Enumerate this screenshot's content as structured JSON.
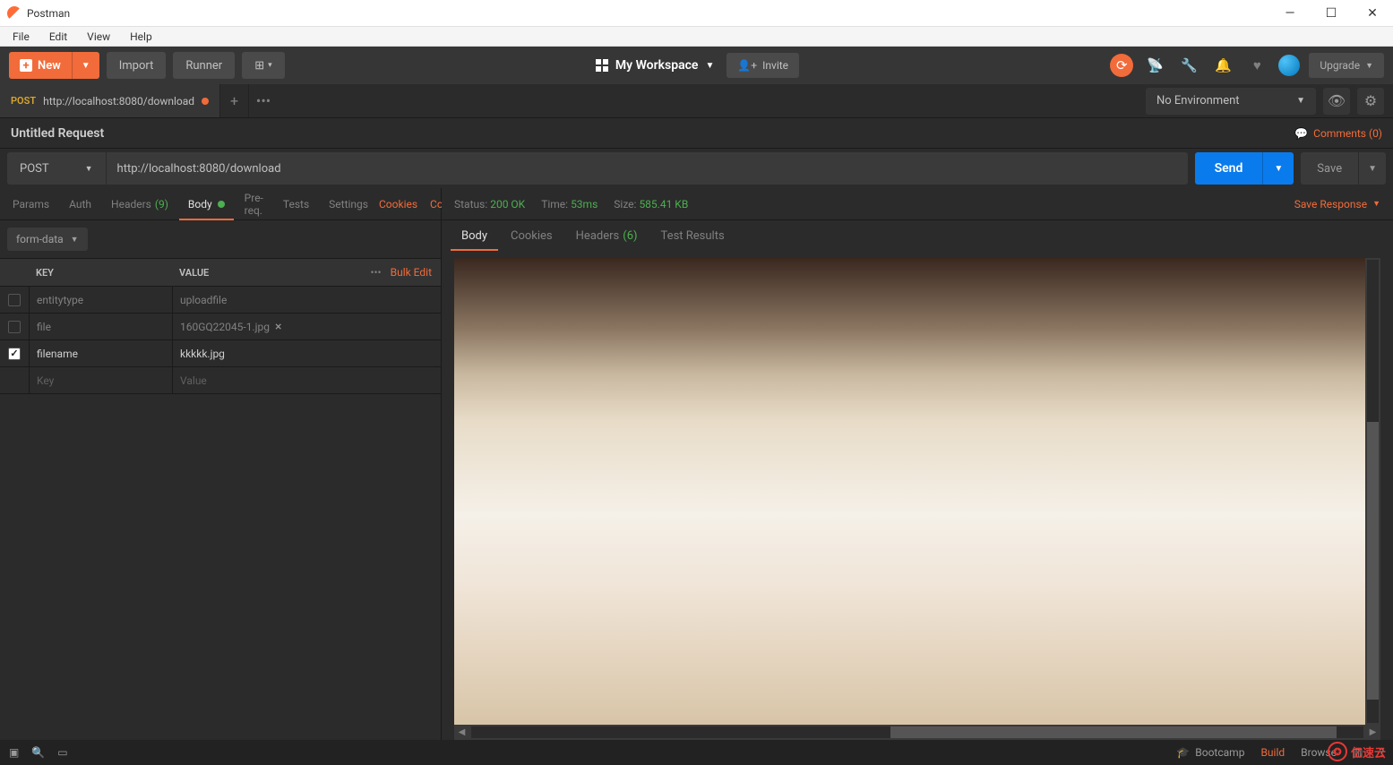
{
  "window": {
    "app_name": "Postman"
  },
  "menus": [
    "File",
    "Edit",
    "View",
    "Help"
  ],
  "toolbar": {
    "new_label": "New",
    "import_label": "Import",
    "runner_label": "Runner",
    "workspace_label": "My Workspace",
    "invite_label": "Invite",
    "upgrade_label": "Upgrade"
  },
  "tabs": {
    "open": [
      {
        "method": "POST",
        "title": "http://localhost:8080/download",
        "dirty": true
      }
    ],
    "env_label": "No Environment"
  },
  "request": {
    "name": "Untitled Request",
    "comments_label": "Comments (0)",
    "method": "POST",
    "url": "http://localhost:8080/download",
    "send_label": "Send",
    "save_label": "Save",
    "req_tabs": {
      "params": "Params",
      "auth": "Auth",
      "headers": "Headers",
      "headers_count": "(9)",
      "body": "Body",
      "prereq": "Pre-req.",
      "tests": "Tests",
      "settings": "Settings",
      "cookies": "Cookies",
      "code": "Code"
    },
    "body_type": "form-data",
    "form_headers": {
      "key": "KEY",
      "value": "VALUE",
      "bulk_edit": "Bulk Edit"
    },
    "form_rows": [
      {
        "checked": false,
        "key": "entitytype",
        "value": "uploadfile",
        "type": "text"
      },
      {
        "checked": false,
        "key": "file",
        "value": "160GQ22045-1.jpg",
        "type": "file"
      },
      {
        "checked": true,
        "key": "filename",
        "value": "kkkkk.jpg",
        "type": "text"
      }
    ],
    "form_placeholder": {
      "key": "Key",
      "value": "Value"
    }
  },
  "response": {
    "status_label": "Status:",
    "status_value": "200 OK",
    "time_label": "Time:",
    "time_value": "53ms",
    "size_label": "Size:",
    "size_value": "585.41 KB",
    "save_response": "Save Response",
    "tabs": {
      "body": "Body",
      "cookies": "Cookies",
      "headers": "Headers",
      "headers_count": "(6)",
      "test_results": "Test Results"
    }
  },
  "statusbar": {
    "bootcamp": "Bootcamp",
    "build": "Build",
    "browse": "Browse"
  },
  "watermark": "亿速云"
}
